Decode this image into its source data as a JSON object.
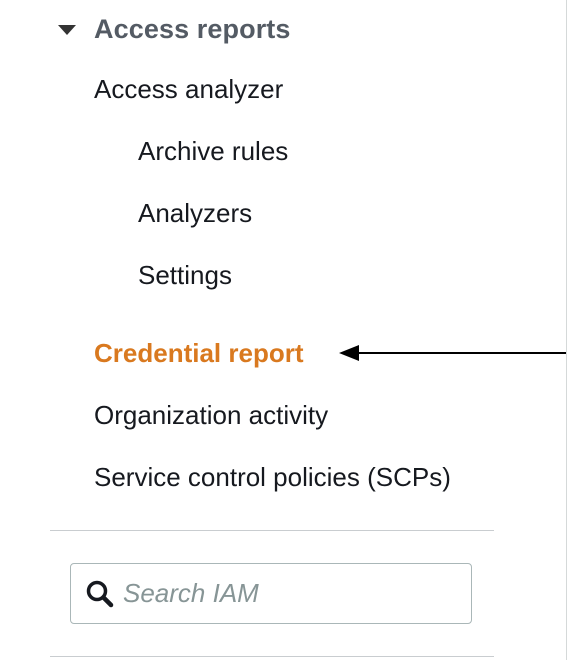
{
  "sidebar": {
    "section": {
      "title": "Access reports",
      "expanded": true
    },
    "items": [
      {
        "label": "Access analyzer"
      },
      {
        "label": "Archive rules"
      },
      {
        "label": "Analyzers"
      },
      {
        "label": "Settings"
      },
      {
        "label": "Credential report",
        "active": true
      },
      {
        "label": "Organization activity"
      },
      {
        "label": "Service control policies (SCPs)"
      }
    ],
    "search": {
      "placeholder": "Search IAM",
      "value": "",
      "icon": "search-icon"
    }
  },
  "colors": {
    "active": "#d9791f",
    "text": "#16191f",
    "header": "#545b64",
    "placeholder": "#879596"
  }
}
